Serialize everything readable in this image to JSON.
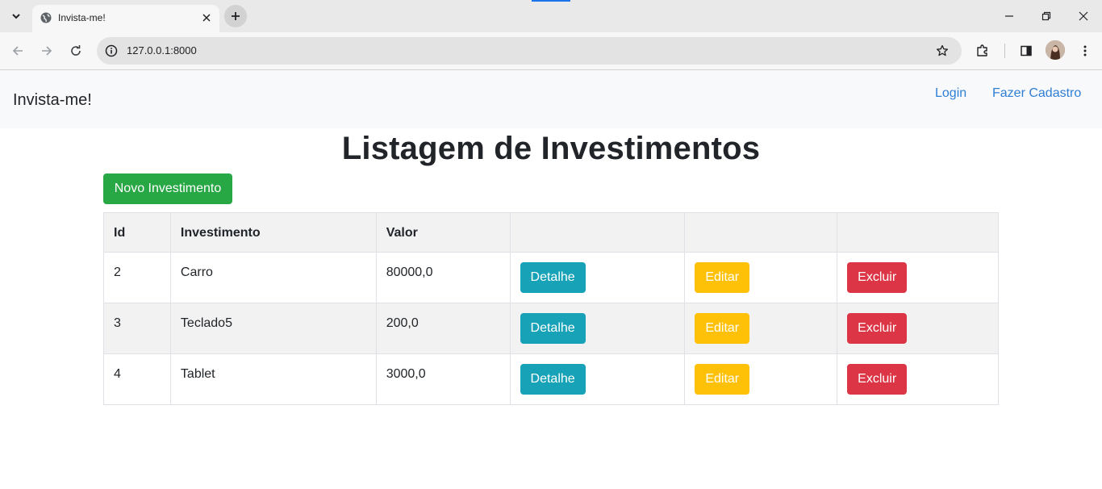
{
  "browser": {
    "tab_title": "Invista-me!",
    "url": "127.0.0.1:8000"
  },
  "navbar": {
    "brand": "Invista-me!",
    "links": [
      "Login",
      "Fazer Cadastro"
    ]
  },
  "page": {
    "title": "Listagem de Investimentos",
    "new_button": "Novo Investimento"
  },
  "table": {
    "headers": [
      "Id",
      "Investimento",
      "Valor",
      "",
      "",
      ""
    ],
    "rows": [
      {
        "id": "2",
        "investimento": "Carro",
        "valor": "80000,0"
      },
      {
        "id": "3",
        "investimento": "Teclado5",
        "valor": "200,0"
      },
      {
        "id": "4",
        "investimento": "Tablet",
        "valor": "3000,0"
      }
    ],
    "actions": {
      "detail": "Detalhe",
      "edit": "Editar",
      "delete": "Excluir"
    }
  },
  "colors": {
    "success": "#28a745",
    "info": "#17a2b8",
    "warning": "#ffc107",
    "danger": "#dc3545",
    "link": "#2f7fd6"
  },
  "icons": [
    "tab-search-icon",
    "globe-icon",
    "close-icon",
    "plus-icon",
    "minimize-icon",
    "restore-icon",
    "back-arrow-icon",
    "forward-arrow-icon",
    "reload-icon",
    "info-icon",
    "star-icon",
    "extensions-icon",
    "side-panel-icon",
    "more-vert-icon"
  ]
}
